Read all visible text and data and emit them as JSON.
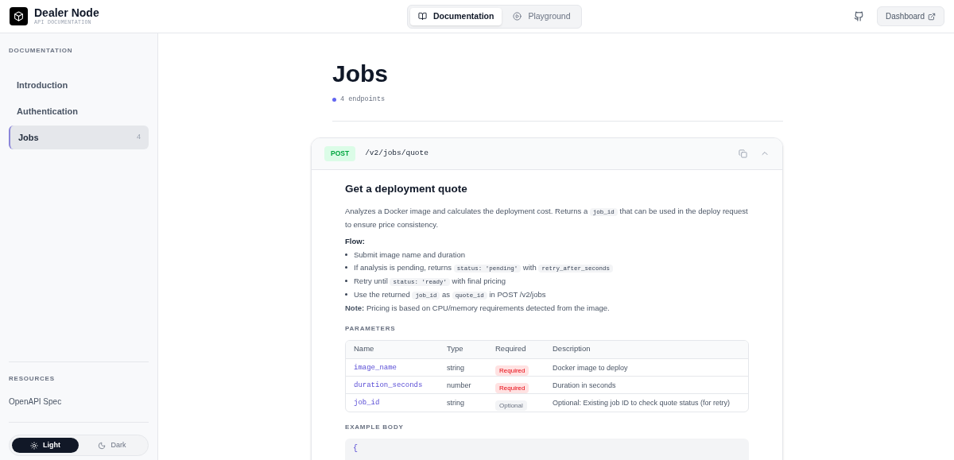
{
  "brand": {
    "name": "Dealer Node",
    "subtitle": "API DOCUMENTATION"
  },
  "top_tabs": [
    {
      "label": "Documentation",
      "selected": true
    },
    {
      "label": "Playground",
      "selected": false
    }
  ],
  "dashboard_button": "Dashboard",
  "sidebar": {
    "heading": "DOCUMENTATION",
    "items": [
      {
        "label": "Introduction",
        "selected": false
      },
      {
        "label": "Authentication",
        "selected": false
      },
      {
        "label": "Jobs",
        "count": "4",
        "selected": true
      }
    ],
    "resources_heading": "RESOURCES",
    "resources": [
      "OpenAPI Spec"
    ],
    "theme": [
      {
        "label": "Light",
        "selected": true
      },
      {
        "label": "Dark",
        "selected": false
      }
    ]
  },
  "page": {
    "title": "Jobs",
    "endpoint_count": "4 endpoints"
  },
  "endpoint": {
    "method": "POST",
    "path": "/v2/jobs/quote",
    "expanded": true,
    "title": "Get a deployment quote",
    "description": [
      {
        "kind": "text",
        "text": "Analyzes a Docker image and calculates the deployment cost. Returns a "
      },
      {
        "kind": "code",
        "text": "job_id"
      },
      {
        "kind": "text",
        "text": " that can be used in the deploy request to ensure price consistency."
      }
    ],
    "flow_heading": "Flow:",
    "flow": [
      [
        {
          "kind": "text",
          "text": "Submit image name and duration"
        }
      ],
      [
        {
          "kind": "text",
          "text": "If analysis is pending, returns "
        },
        {
          "kind": "code",
          "text": "status: 'pending'"
        },
        {
          "kind": "text",
          "text": " with "
        },
        {
          "kind": "code",
          "text": "retry_after_seconds"
        }
      ],
      [
        {
          "kind": "text",
          "text": "Retry until "
        },
        {
          "kind": "code",
          "text": "status: 'ready'"
        },
        {
          "kind": "text",
          "text": " with final pricing"
        }
      ],
      [
        {
          "kind": "text",
          "text": "Use the returned "
        },
        {
          "kind": "code",
          "text": "job_id"
        },
        {
          "kind": "text",
          "text": " as "
        },
        {
          "kind": "code",
          "text": "quote_id"
        },
        {
          "kind": "text",
          "text": " in POST /v2/jobs"
        }
      ]
    ],
    "note": "**Note:** Pricing is based on CPU/memory requirements detected from the image.",
    "parameters_heading": "PARAMETERS",
    "columns": [
      "Name",
      "Type",
      "Required",
      "Description"
    ],
    "parameters": [
      {
        "name": "image_name",
        "type": "string",
        "required": true,
        "badge": "Required",
        "description": "Docker image to deploy"
      },
      {
        "name": "duration_seconds",
        "type": "number",
        "required": true,
        "badge": "Required",
        "description": "Duration in seconds"
      },
      {
        "name": "job_id",
        "type": "string",
        "required": false,
        "badge": "Optional",
        "description": "Optional: Existing job ID to check quote status (for retry)"
      }
    ],
    "example_heading": "EXAMPLE BODY",
    "example_lines": [
      "{"
    ]
  }
}
